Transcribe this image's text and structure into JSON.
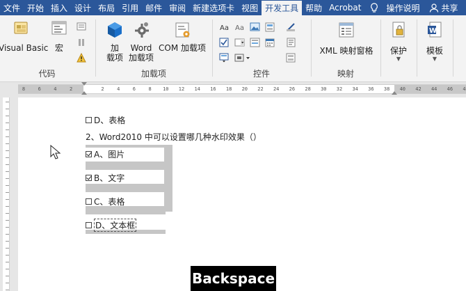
{
  "menu": {
    "tabs": [
      "文件",
      "开始",
      "插入",
      "设计",
      "布局",
      "引用",
      "邮件",
      "审阅",
      "新建选项卡",
      "视图",
      "开发工具",
      "帮助",
      "Acrobat"
    ],
    "active_tab": "开发工具",
    "tell_me": "操作说明",
    "share": "共享"
  },
  "ribbon": {
    "code": {
      "label": "代码",
      "visual_basic": "Visual Basic",
      "macros": "宏"
    },
    "addins": {
      "label": "加载项",
      "addins_btn_line1": "加",
      "addins_btn_line2": "载项",
      "word_addins_line1": "Word",
      "word_addins_line2": "加载项",
      "com_addins": "COM 加载项"
    },
    "controls": {
      "label": "控件"
    },
    "mapping": {
      "label": "映射",
      "xml_pane": "XML 映射窗格"
    },
    "protect": {
      "label": "保护"
    },
    "templates": {
      "label": "模板"
    }
  },
  "ruler": {
    "ticks": [
      "8",
      "6",
      "4",
      "2",
      "",
      "2",
      "4",
      "6",
      "8",
      "10",
      "12",
      "14",
      "16",
      "18",
      "20",
      "22",
      "24",
      "26",
      "28",
      "30",
      "32",
      "34",
      "36",
      "38",
      "40",
      "42",
      "44",
      "46",
      "48"
    ]
  },
  "document": {
    "prev_option": "D、表格",
    "question": "2、Word2010 中可以设置哪几种水印效果（）",
    "options": [
      {
        "text": "A、图片",
        "checked": true
      },
      {
        "text": "B、文字",
        "checked": true
      },
      {
        "text": "C、表格",
        "checked": false
      },
      {
        "text": "D、文本框",
        "checked": false
      }
    ]
  },
  "key_badge": "Backspace",
  "colors": {
    "menu_bg": "#2b579a",
    "ribbon_bg": "#f3f3f3",
    "selection": "#c6c6c6"
  }
}
